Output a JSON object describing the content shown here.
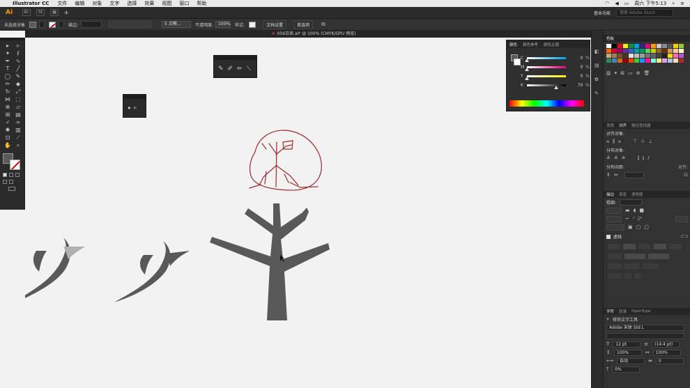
{
  "menubar": {
    "app_name": "Illustrator CC",
    "items": [
      "文件",
      "编辑",
      "对象",
      "文字",
      "选择",
      "效果",
      "视图",
      "窗口",
      "帮助"
    ],
    "datetime": "周六 下午5:13"
  },
  "appbar": {
    "logo": "Ai",
    "workspace": "基本功能",
    "search_placeholder": "搜索 Adobe Stock"
  },
  "control_bar": {
    "selection_label": "未选择对象",
    "stroke_label": "描边:",
    "brush_value": "5 点椭...",
    "opacity_label": "不透明度:",
    "opacity_value": "100%",
    "style_label": "样式:",
    "doc_setup_button": "文档设置",
    "preferences_button": "首选项"
  },
  "document": {
    "tab_title": "056日来.ai* @ 100% (CMYK/GPU 预览)"
  },
  "color_panel": {
    "tabs": [
      "颜色",
      "颜色参考",
      "颜色主题"
    ],
    "channels": [
      {
        "name": "C",
        "value": "0",
        "pos": 0.0
      },
      {
        "name": "M",
        "value": "0",
        "pos": 0.0
      },
      {
        "name": "Y",
        "value": "0",
        "pos": 0.0
      },
      {
        "name": "K",
        "value": "70",
        "pos": 0.7
      }
    ],
    "percent": "%"
  },
  "swatches_panel": {
    "tab": "色板",
    "colors": [
      "#ffffff",
      "#000000",
      "#e3001b",
      "#ffed00",
      "#00963f",
      "#009fe3",
      "#312783",
      "#e5007e",
      "#ff9900",
      "#c8c8c8",
      "#8a8a8a",
      "#555555",
      "#ffcc00",
      "#99cc33",
      "#ff6600",
      "#cc0033",
      "#990066",
      "#663399",
      "#3366cc",
      "#00a0a0",
      "#009966",
      "#66cc66",
      "#cccc00",
      "#996633",
      "#663300",
      "#cc9966",
      "#ffcc99",
      "#ffffcc",
      "#c8a97e",
      "#a67c52",
      "#7a5230",
      "#4d3319",
      "#e0e0e0",
      "#bdbdbd",
      "#9e9e9e",
      "#757575",
      "#616161",
      "#424242",
      "#212121",
      "#ffd700",
      "#ff69b4",
      "#ba55d3",
      "#2e8b57",
      "#4682b4",
      "#d2691e",
      "#8b0000",
      "#ff4500",
      "#32cd32",
      "#1e90ff",
      "#ff1493",
      "#7fffd4",
      "#f0e68c",
      "#dda0dd",
      "#b0c4de",
      "#f5deb3",
      "#a52a2a"
    ]
  },
  "align_panel": {
    "tabs": [
      "变换",
      "对齐",
      "路径查找器"
    ],
    "align_objects": "对齐对象:",
    "distribute_objects": "分布对象:",
    "distribute_spacing": "分布间距:",
    "align_to": "对齐:"
  },
  "stroke_panel": {
    "tabs": [
      "描边",
      "渐变",
      "透明度"
    ],
    "weight_label": "粗细:",
    "dashed_label": "虚线"
  },
  "char_panel": {
    "tabs": [
      "字符",
      "段落",
      "OpenType"
    ],
    "tool_label": "修饰文字工具",
    "font_name": "Adobe 宋体 Std L",
    "font_size": "12 pt",
    "leading": "(14.4 pt)",
    "vscale": "100%",
    "hscale": "100%",
    "kerning": "自动",
    "tracking": "0",
    "baseline": "0%"
  },
  "colors": {
    "tree_gray": "#595959",
    "sketch_red": "#9b2a2a",
    "canvas_bg": "#f2f2f2",
    "ui_dark": "#2b2b2b",
    "accent_orange": "#ff9a00"
  }
}
